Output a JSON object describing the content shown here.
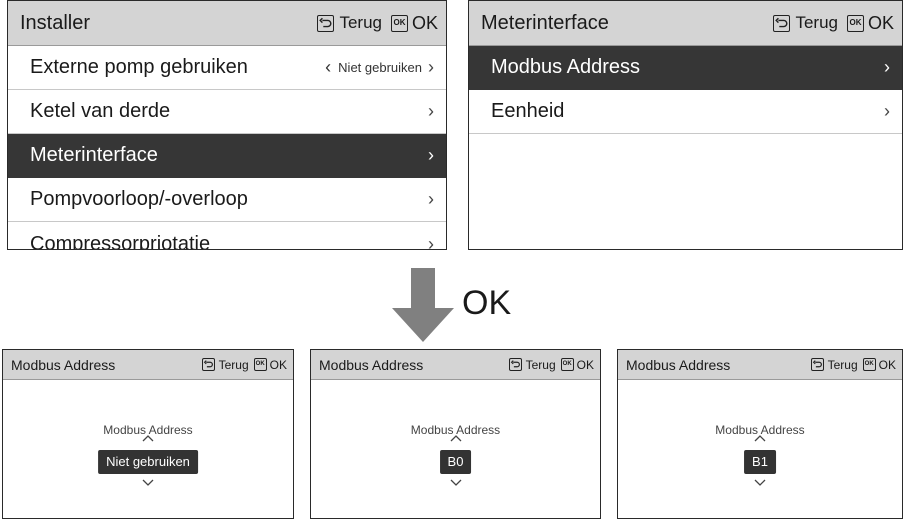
{
  "installer_panel": {
    "title": "Installer",
    "back_label": "Terug",
    "ok_icon": "OK",
    "ok_label": "OK",
    "items": [
      {
        "label": "Externe pomp gebruiken",
        "value": "Niet gebruiken"
      },
      {
        "label": "Ketel van derde"
      },
      {
        "label": "Meterinterface"
      },
      {
        "label": "Pompvoorloop/-overloop"
      },
      {
        "label": "Compressorpriotatie"
      }
    ]
  },
  "meter_panel": {
    "title": "Meterinterface",
    "back_label": "Terug",
    "ok_icon": "OK",
    "ok_label": "OK",
    "items": [
      {
        "label": "Modbus Address"
      },
      {
        "label": "Eenheid"
      }
    ]
  },
  "transition": {
    "label": "OK",
    "icon": "down-arrow-icon"
  },
  "address_panels": [
    {
      "title": "Modbus Address",
      "back_label": "Terug",
      "ok_icon": "OK",
      "ok_label": "OK",
      "field_label": "Modbus Address",
      "value": "Niet gebruiken"
    },
    {
      "title": "Modbus Address",
      "back_label": "Terug",
      "ok_icon": "OK",
      "ok_label": "OK",
      "field_label": "Modbus Address",
      "value": "B0"
    },
    {
      "title": "Modbus Address",
      "back_label": "Terug",
      "ok_icon": "OK",
      "ok_label": "OK",
      "field_label": "Modbus Address",
      "value": "B1"
    }
  ],
  "colors": {
    "header_bg": "#d4d4d4",
    "selected_bg": "#363636",
    "arrow": "#808080"
  }
}
